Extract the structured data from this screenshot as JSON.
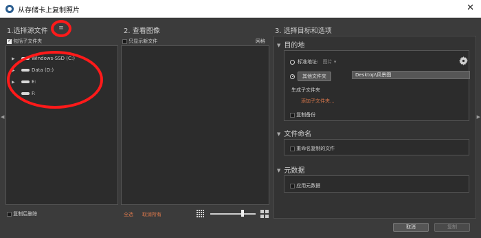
{
  "window": {
    "title": "从存储卡上复制照片",
    "close_glyph": "✕"
  },
  "source": {
    "heading": "1.选择源文件",
    "menu_icon": "hamburger-icon",
    "include_subfolders": {
      "label": "包括子文件夹",
      "checked": true
    },
    "drives": [
      {
        "label": "Windows-SSD (C:)",
        "icon": "drive-icon"
      },
      {
        "label": "Data (D:)",
        "icon": "drive-icon"
      },
      {
        "label": "E:",
        "icon": "drive-icon"
      },
      {
        "label": "F:",
        "icon": "drive-icon"
      }
    ],
    "delete_after_copy": {
      "label": "复制后删除",
      "checked": false
    }
  },
  "preview": {
    "heading": "2. 查看图像",
    "show_new_only": {
      "label": "只显示新文件",
      "checked": false
    },
    "grid_label": "网格",
    "select_all": "全选",
    "deselect_all": "取消所有"
  },
  "target": {
    "heading": "3. 选择目标和选项",
    "destination": {
      "title": "目的地",
      "standard_label": "标准地址:",
      "standard_value": "图片",
      "other_folder_button": "其他文件夹",
      "path": "Desktop\\风景图",
      "create_subfolder_label": "生成子文件夹",
      "add_subfolder_link": "添加子文件夹...",
      "backup": {
        "label": "复制备份",
        "checked": false
      }
    },
    "file_naming": {
      "title": "文件命名",
      "rename": {
        "label": "重命名复制的文件",
        "checked": false
      }
    },
    "metadata": {
      "title": "元数据",
      "apply": {
        "label": "应用元数据",
        "checked": false
      }
    }
  },
  "footer": {
    "cancel": "取消",
    "copy": "复制"
  },
  "annotation": {
    "color": "#ff1a1a"
  }
}
